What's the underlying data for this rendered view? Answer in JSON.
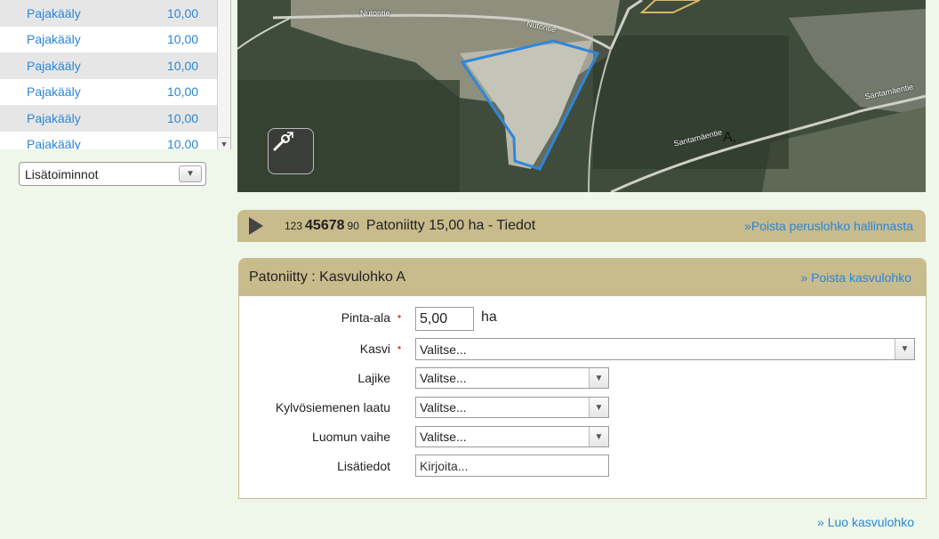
{
  "list": {
    "rows": [
      {
        "name": "Pajakääly",
        "value": "10,00"
      },
      {
        "name": "Pajakääly",
        "value": "10,00"
      },
      {
        "name": "Pajakääly",
        "value": "10,00"
      },
      {
        "name": "Pajakääly",
        "value": "10,00"
      },
      {
        "name": "Pajakääly",
        "value": "10,00"
      },
      {
        "name": "Pajakääly",
        "value": "10,00"
      }
    ],
    "more_actions": "Lisätoiminnot"
  },
  "map": {
    "road_labels": [
      "Nutontie",
      "Nutontie",
      "Santamäentie",
      "Santamäentie"
    ],
    "marker": "A,"
  },
  "parcel": {
    "id_prefix": "123",
    "id_main": "45678",
    "id_suffix": "90",
    "title": "Patoniitty 15,00 ha -  Tiedot",
    "remove_link": "»Poista peruslohko hallinnasta"
  },
  "form": {
    "title": "Patoniitty : Kasvulohko A",
    "remove_link": "» Poista kasvulohko",
    "area_label": "Pinta-ala",
    "area_value": "5,00",
    "area_unit": "ha",
    "crop_label": "Kasvi",
    "crop_value": "Valitse...",
    "variety_label": "Lajike",
    "variety_value": "Valitse...",
    "seed_label": "Kylvösiemenen laatu",
    "seed_value": "Valitse...",
    "organic_label": "Luomun vaihe",
    "organic_value": "Valitse...",
    "notes_label": "Lisätiedot",
    "notes_placeholder": "Kirjoita..."
  },
  "create_link": "» Luo kasvulohko",
  "colors": {
    "page_bg": "#eef7e9",
    "header_tan": "#c8bb8c",
    "link_blue": "#2a86d6",
    "required_red": "#e0433b",
    "parcel_outline": "#2f86d8"
  }
}
